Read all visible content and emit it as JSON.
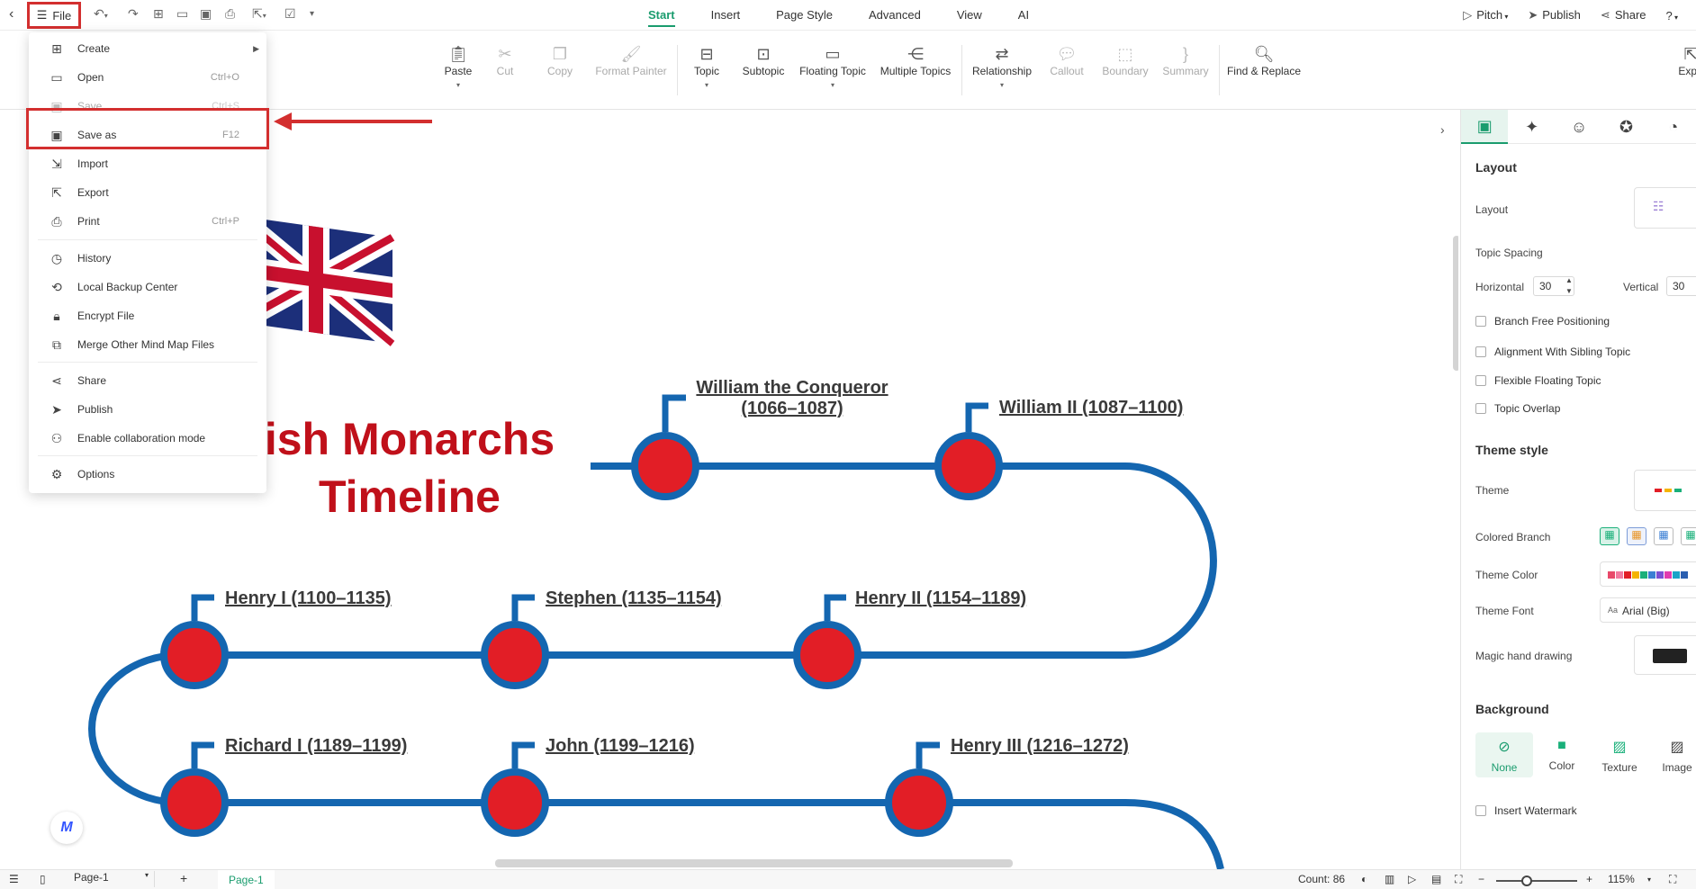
{
  "topbar": {
    "file_label": "File",
    "tabs": [
      "Start",
      "Insert",
      "Page Style",
      "Advanced",
      "View",
      "AI"
    ],
    "active_tab": "Start",
    "pitch_label": "Pitch",
    "publish_label": "Publish",
    "share_label": "Share",
    "help_icon": "help-icon"
  },
  "ribbon": {
    "paste": "Paste",
    "cut": "Cut",
    "copy": "Copy",
    "format_painter": "Format Painter",
    "topic": "Topic",
    "subtopic": "Subtopic",
    "floating_topic": "Floating Topic",
    "multiple_topics": "Multiple Topics",
    "relationship": "Relationship",
    "callout": "Callout",
    "boundary": "Boundary",
    "summary": "Summary",
    "find_replace": "Find & Replace",
    "export_cut": "Expo"
  },
  "file_menu": {
    "create": "Create",
    "open": "Open",
    "open_sc": "Ctrl+O",
    "save": "Save",
    "save_sc": "Ctrl+S",
    "save_as": "Save as",
    "save_as_sc": "F12",
    "import": "Import",
    "export": "Export",
    "print": "Print",
    "print_sc": "Ctrl+P",
    "history": "History",
    "local_backup": "Local Backup Center",
    "encrypt": "Encrypt File",
    "merge": "Merge Other Mind Map Files",
    "share": "Share",
    "publish": "Publish",
    "collab": "Enable collaboration mode",
    "options": "Options"
  },
  "canvas": {
    "title_line1": "ish Monarchs",
    "title_line2": "Timeline",
    "monarchs": [
      {
        "name": "William the Conqueror (1066–1087)"
      },
      {
        "name": "William II (1087–1100)"
      },
      {
        "name": "Henry I (1100–1135)"
      },
      {
        "name": "Stephen (1135–1154)"
      },
      {
        "name": "Henry II (1154–1189)"
      },
      {
        "name": "Richard I (1189–1199)"
      },
      {
        "name": "John (1199–1216)"
      },
      {
        "name": "Henry III (1216–1272)"
      }
    ],
    "colors": {
      "path": "#1466b0",
      "node": "#e21e26",
      "title": "#c0101a"
    }
  },
  "right_panel": {
    "layout_section": "Layout",
    "layout_label": "Layout",
    "topic_spacing": "Topic Spacing",
    "horizontal_label": "Horizontal",
    "horizontal_value": "30",
    "vertical_label": "Vertical",
    "vertical_value": "30",
    "branch_free": "Branch Free Positioning",
    "alignment_sibling": "Alignment With Sibling Topic",
    "flexible_floating": "Flexible Floating Topic",
    "topic_overlap": "Topic Overlap",
    "theme_style": "Theme style",
    "theme_label": "Theme",
    "colored_branch": "Colored Branch",
    "theme_color": "Theme Color",
    "theme_font": "Theme Font",
    "theme_font_value": "Arial (Big)",
    "magic_hand": "Magic hand drawing",
    "background": "Background",
    "bg_none": "None",
    "bg_color": "Color",
    "bg_texture": "Texture",
    "bg_image": "Image",
    "insert_watermark": "Insert Watermark"
  },
  "statusbar": {
    "page_select": "Page-1",
    "page_tab": "Page-1",
    "count": "Count: 86",
    "zoom": "115%"
  }
}
